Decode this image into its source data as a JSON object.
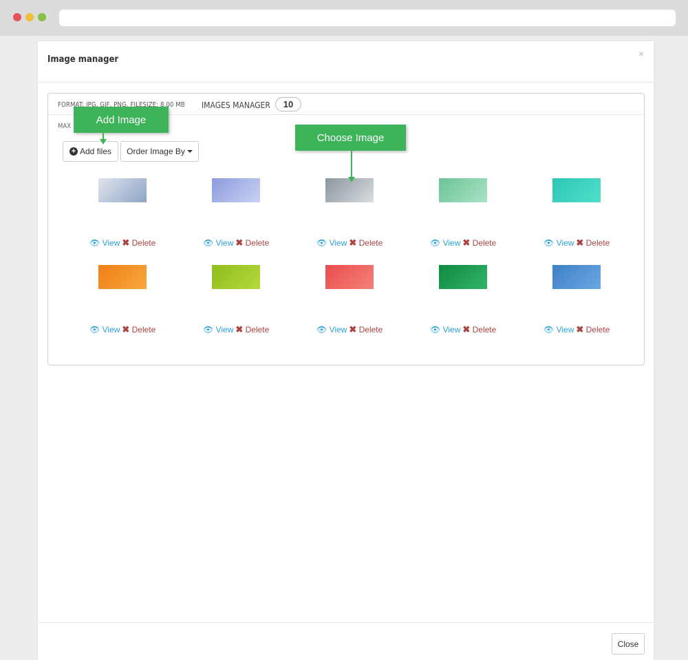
{
  "window": {
    "controls": [
      "close",
      "minimize",
      "maximize"
    ]
  },
  "modal": {
    "title": "Image manager",
    "close_glyph": "×",
    "format_text": "FORMAT: JPG, GIF, PNG, FILESIZE: 8.00 MB",
    "manager_title": "IMAGES MANAGER",
    "image_count": "10",
    "max_text": "MAX",
    "add_files_label": "Add files",
    "order_label": "Order Image By",
    "view_label": "View",
    "delete_label": "Delete",
    "close_label": "Close"
  },
  "callouts": {
    "add_image": "Add Image",
    "choose_image": "Choose Image"
  },
  "images": [
    {
      "name": "brochure-mockup",
      "colors": [
        "#dfe4ec",
        "#8fa4c6"
      ]
    },
    {
      "name": "stationery-mockup",
      "colors": [
        "#8e9adf",
        "#c8d2f2"
      ]
    },
    {
      "name": "desk-mockup",
      "colors": [
        "#8b969e",
        "#d8dde0"
      ]
    },
    {
      "name": "keyboard-mockup",
      "colors": [
        "#6cc39a",
        "#a9e2c4"
      ]
    },
    {
      "name": "teal-banner",
      "colors": [
        "#2ec5b6",
        "#4fe0c9"
      ]
    },
    {
      "name": "orange-banner",
      "colors": [
        "#f07d1a",
        "#f7a93b"
      ]
    },
    {
      "name": "lime-banner",
      "colors": [
        "#8fbd1c",
        "#b6d83e"
      ]
    },
    {
      "name": "red-banner",
      "colors": [
        "#ea4d4e",
        "#f48277"
      ]
    },
    {
      "name": "green-banner",
      "colors": [
        "#0f8a43",
        "#33b36a"
      ]
    },
    {
      "name": "blue-banner",
      "colors": [
        "#3f7fc6",
        "#6aa8e2"
      ]
    }
  ],
  "colors": {
    "link": "#2a9fd6",
    "danger": "#a94442",
    "callout": "#3db35a"
  }
}
